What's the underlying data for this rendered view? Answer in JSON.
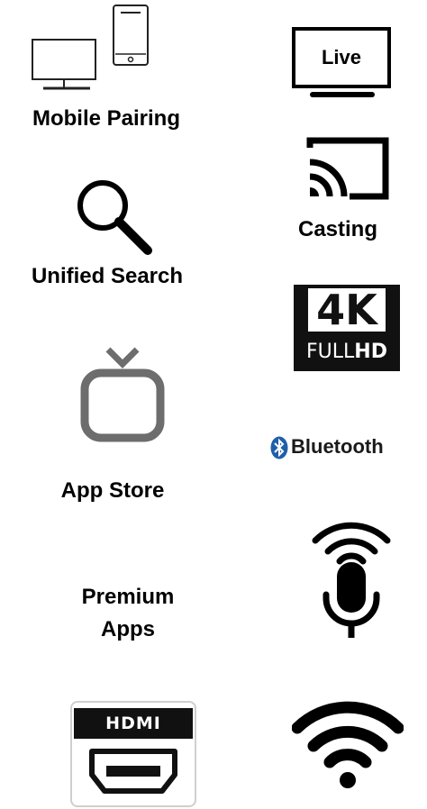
{
  "features": {
    "mobile_pairing": {
      "label": "Mobile Pairing",
      "icon": "devices-icon"
    },
    "live": {
      "label": "Live",
      "icon": "tv-live-icon"
    },
    "casting": {
      "label": "Casting",
      "icon": "cast-icon"
    },
    "unified_search": {
      "label": "Unified Search",
      "icon": "search-icon"
    },
    "fullhd_4k": {
      "top": "4K",
      "bottom_light": "FULL",
      "bottom_bold": "HD",
      "icon": "4k-fullhd-icon"
    },
    "app_store": {
      "label": "App Store",
      "icon": "tv-app-icon"
    },
    "bluetooth": {
      "label": "Bluetooth",
      "icon": "bluetooth-icon"
    },
    "premium_apps": {
      "line1": "Premium",
      "line2": "Apps"
    },
    "voice": {
      "icon": "voice-mic-icon"
    },
    "hdmi": {
      "label": "HDMI",
      "icon": "hdmi-port-icon"
    },
    "wifi": {
      "icon": "wifi-icon"
    }
  },
  "colors": {
    "black": "#000000",
    "gray": "#6d6d6d",
    "bluetooth_blue": "#1f5fa8"
  }
}
